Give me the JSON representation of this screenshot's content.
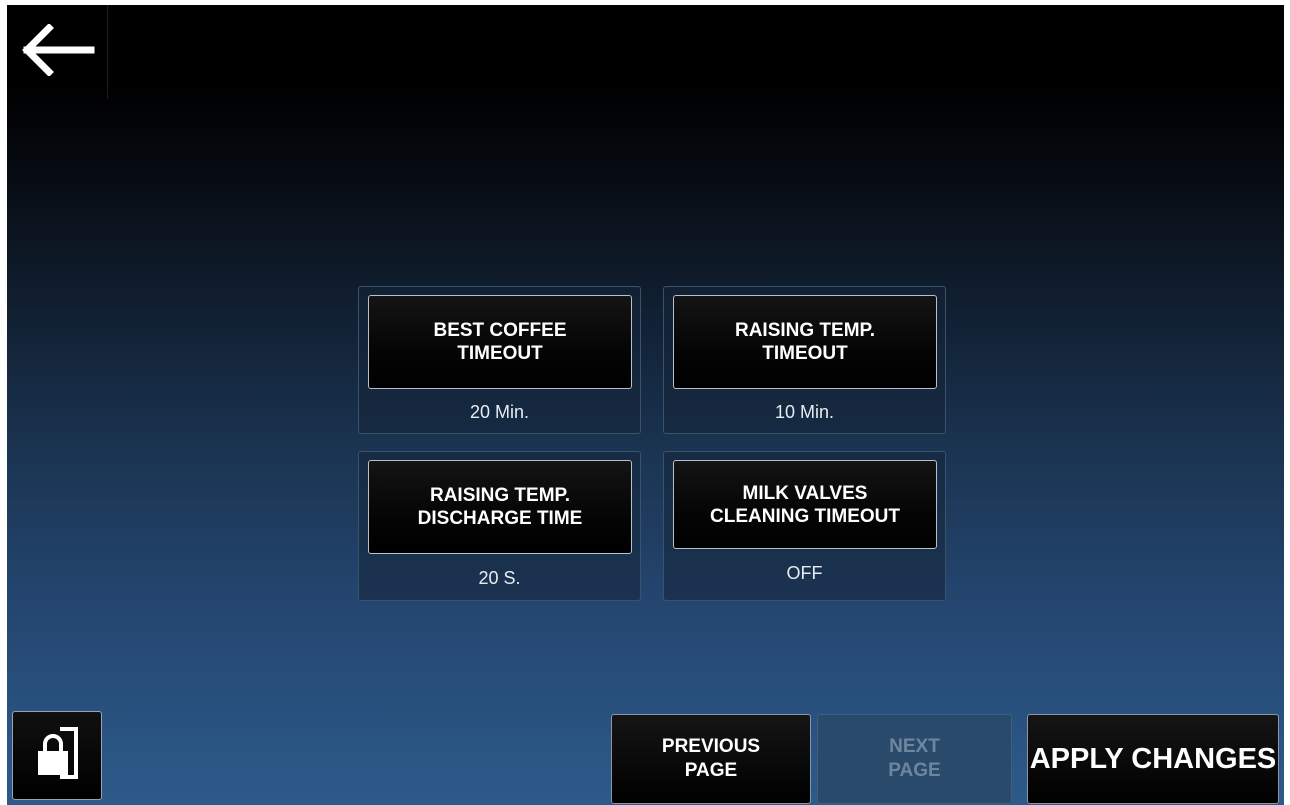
{
  "nav": {
    "back_icon": "arrow-left-icon"
  },
  "settings": [
    {
      "label_line1": "BEST COFFEE",
      "label_line2": "TIMEOUT",
      "value": "20 Min."
    },
    {
      "label_line1": "RAISING TEMP.",
      "label_line2": "TIMEOUT",
      "value": "10 Min."
    },
    {
      "label_line1": "RAISING TEMP.",
      "label_line2": "DISCHARGE TIME",
      "value": "20 S."
    },
    {
      "label_line1": "MILK VALVES",
      "label_line2": "CLEANING TIMEOUT",
      "value": "OFF"
    }
  ],
  "footer": {
    "lock_icon": "lock-exit-icon",
    "previous_line1": "PREVIOUS",
    "previous_line2": "PAGE",
    "next_line1": "NEXT",
    "next_line2": "PAGE",
    "apply_label": "APPLY CHANGES"
  }
}
